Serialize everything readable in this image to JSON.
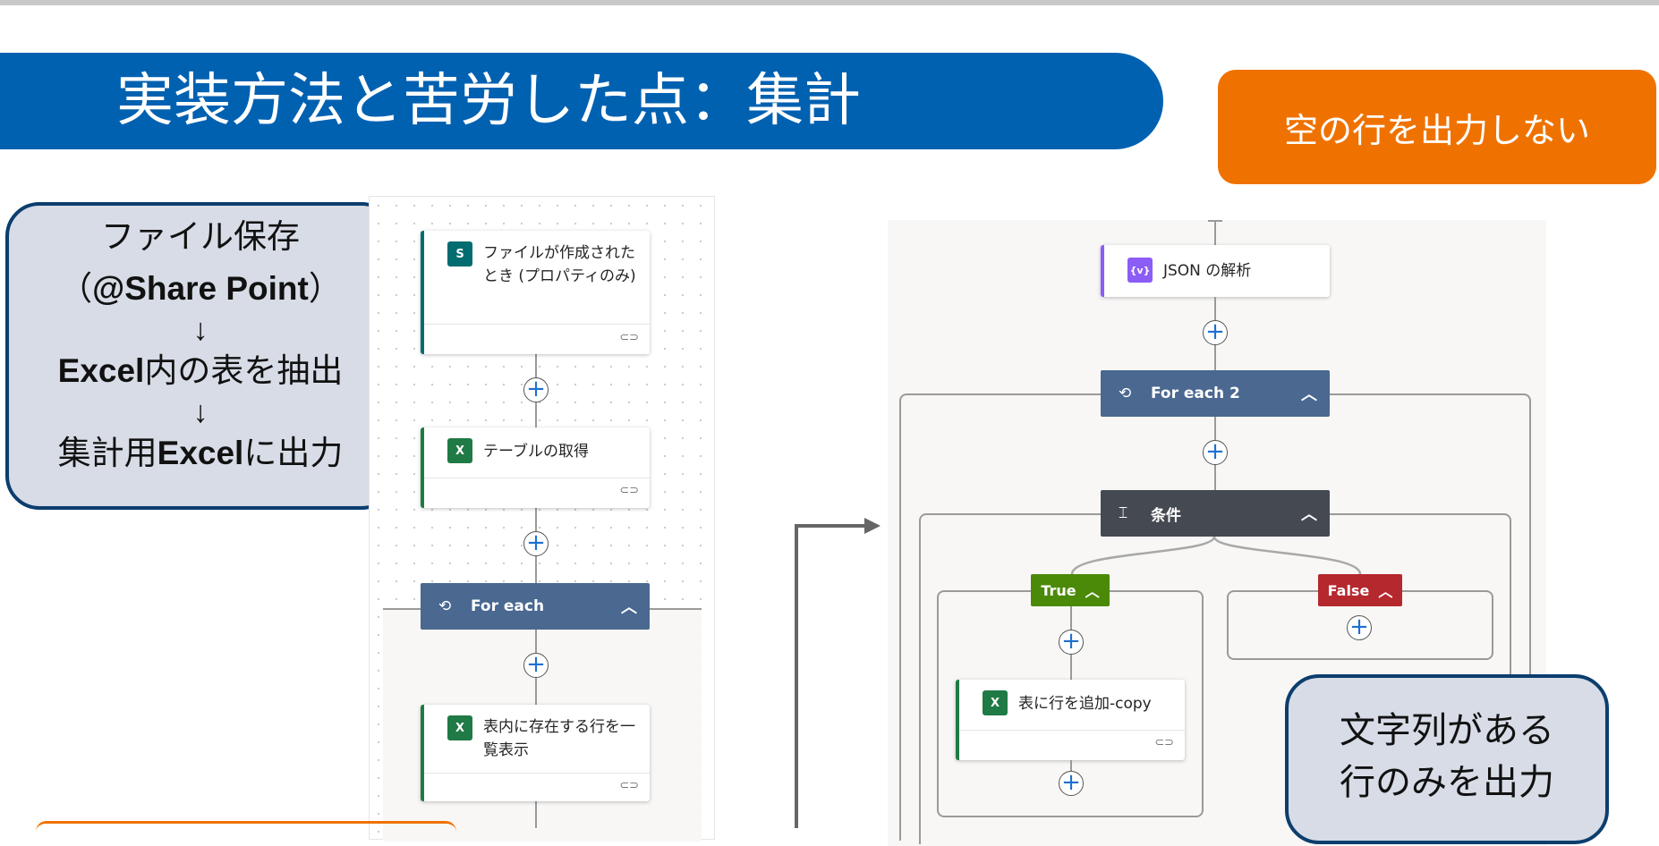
{
  "slide": {
    "title": "実装方法と苦労した点：集計",
    "badge": "空の行を出力しない",
    "callout_left": {
      "line1": "ファイル保存",
      "line2_paren_open": "（",
      "line2_bold": "@Share Point",
      "line2_paren_close": "）",
      "arrow1": "↓",
      "line3_bold": "Excel",
      "line3_rest": "内の表を抽出",
      "arrow2": "↓",
      "line4_pre": "集計用",
      "line4_bold": "Excel",
      "line4_post": "に出力"
    },
    "callout_right": {
      "line1": "文字列がある",
      "line2": "行のみを出力"
    }
  },
  "left_flow": {
    "trigger_label": "ファイルが作成されたとき (プロパティのみ)",
    "get_table_label": "テーブルの取得",
    "for_each_label": "For each",
    "list_rows_label": "表内に存在する行を一覧表示"
  },
  "right_flow": {
    "parse_json_label": "JSON の解析",
    "for_each2_label": "For each 2",
    "condition_label": "条件",
    "true_label": "True",
    "false_label": "False",
    "add_row_label": "表に行を追加-copy"
  },
  "icons": {
    "sharepoint": "sharepoint-icon",
    "excel": "excel-icon",
    "loop": "loop-icon",
    "condition": "condition-icon",
    "json": "json-icon",
    "chevron": "chevron-up-icon",
    "plus": "add-step-icon",
    "link": "link-icon"
  },
  "colors": {
    "banner": "#0161b1",
    "badge": "#ef7200",
    "callout_bg": "#d7dce6",
    "callout_border": "#0c3e6e",
    "loop_header": "#4a6890",
    "condition_header": "#454a52",
    "true_tag": "#4b8a08",
    "false_tag": "#b5282e",
    "excel": "#1f7a45",
    "json": "#8b5cf6"
  }
}
